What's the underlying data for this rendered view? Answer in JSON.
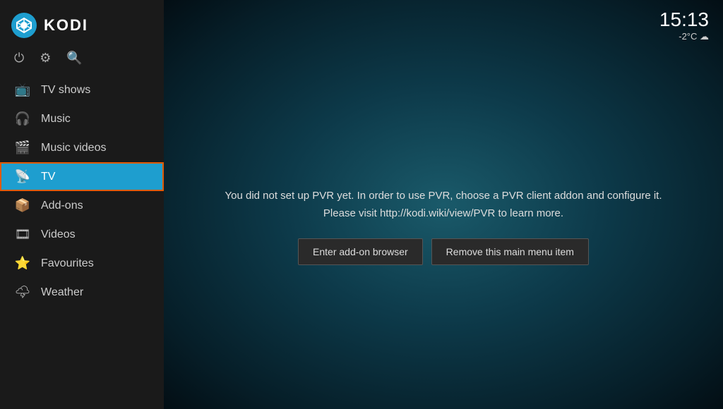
{
  "app": {
    "title": "KODI"
  },
  "clock": {
    "time": "15:13",
    "weather": "-2°C ☁"
  },
  "toolbar": {
    "power_icon": "⏻",
    "settings_icon": "⚙",
    "search_icon": "🔍"
  },
  "sidebar": {
    "items": [
      {
        "id": "tv-shows",
        "label": "TV shows",
        "icon": "📺"
      },
      {
        "id": "music",
        "label": "Music",
        "icon": "🎧"
      },
      {
        "id": "music-videos",
        "label": "Music videos",
        "icon": "🎬"
      },
      {
        "id": "tv",
        "label": "TV",
        "icon": "📡",
        "active": true
      },
      {
        "id": "add-ons",
        "label": "Add-ons",
        "icon": "📦"
      },
      {
        "id": "videos",
        "label": "Videos",
        "icon": "🎞"
      },
      {
        "id": "favourites",
        "label": "Favourites",
        "icon": "⭐"
      },
      {
        "id": "weather",
        "label": "Weather",
        "icon": "🌩"
      }
    ]
  },
  "main": {
    "pvr_message_line1": "You did not set up PVR yet. In order to use PVR, choose a PVR client addon and configure it.",
    "pvr_message_line2": "Please visit http://kodi.wiki/view/PVR to learn more.",
    "btn_addon_browser": "Enter add-on browser",
    "btn_remove_menu": "Remove this main menu item"
  }
}
